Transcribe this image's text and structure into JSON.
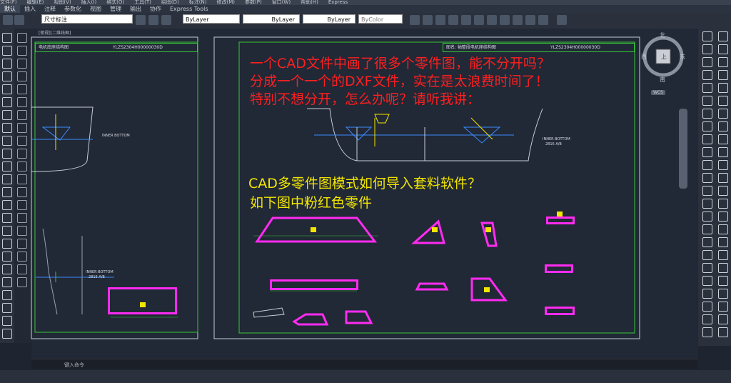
{
  "menubar": {
    "items": [
      "文件(F)",
      "编辑(E)",
      "视图(V)",
      "插入(I)",
      "格式(O)",
      "工具(T)",
      "绘图(D)",
      "标注(N)",
      "修改(M)",
      "参数(P)",
      "窗口(W)",
      "帮助(H)",
      "Express"
    ]
  },
  "ribbon_tabs": [
    "默认",
    "插入",
    "注释",
    "参数化",
    "视图",
    "管理",
    "输出",
    "协作",
    "Express Tools"
  ],
  "toolbar": {
    "dimstyle": "尺寸标注",
    "layer": "ByLayer",
    "linetype": "ByLayer",
    "lineweight": "ByLayer",
    "color": "ByColor"
  },
  "drawing_tab": "[俯视][二维线框]",
  "sheet_left": {
    "drawing_no": "YLZS2304H00000030D",
    "title": "电机底座结构图"
  },
  "sheet_right": {
    "drawing_no": "YLZS2304H00000030D",
    "title": "图名: 轴整段电机座结构图"
  },
  "overlay": {
    "line1": "一个CAD文件中画了很多个零件图，能不分开吗？",
    "line2": "分成一个一个的DXF文件，实在是太浪费时间了！",
    "line3": "特别不想分开，怎么办呢？请听我讲：",
    "line4": "CAD多零件图模式如何导入套料软件？",
    "line5": "如下图中粉红色零件"
  },
  "annotations": {
    "inner_bottom": "INNER BOTTOM",
    "inner_bottom_sub": "2816 A/B",
    "inner_bottom_right": "INNER BOTTOM",
    "inner_bottom_right_sub": "2816 A/B"
  },
  "viewcube": {
    "north": "北",
    "south": "南",
    "east": "东",
    "west": "西",
    "center": "上",
    "wcs": "WCS"
  },
  "command_prompt": "键入命令",
  "colors": {
    "accent_pink": "#ff2bf1",
    "title_green": "#37c837",
    "overlay_red": "#ff1f1f",
    "overlay_yellow": "#f2e600",
    "canvas": "#212836"
  }
}
